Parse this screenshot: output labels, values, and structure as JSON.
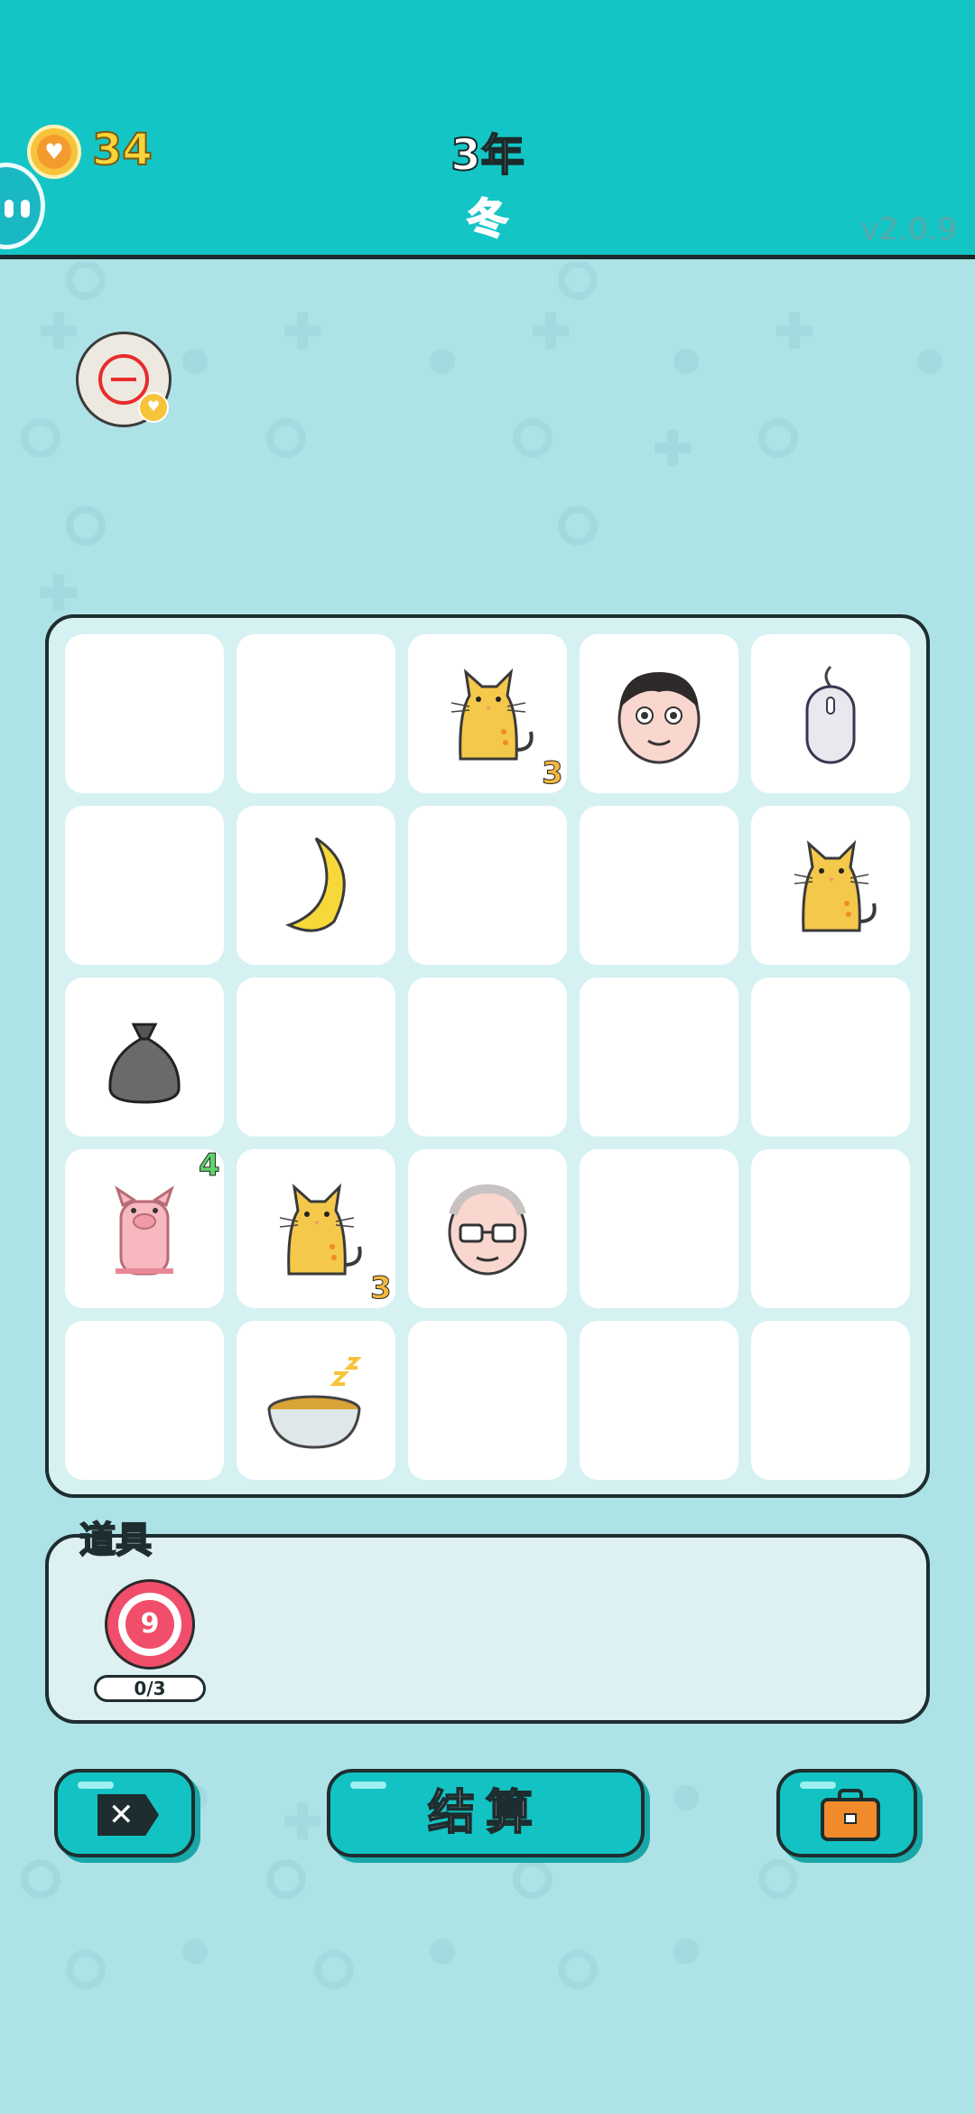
{
  "header": {
    "coins": "34",
    "year": "3年",
    "season": "冬",
    "version": "v2.0.9"
  },
  "board": {
    "rows": 5,
    "cols": 5,
    "cells": [
      {
        "row": 0,
        "col": 2,
        "item": "cat-icon",
        "badge": "3"
      },
      {
        "row": 0,
        "col": 3,
        "item": "man-face-icon"
      },
      {
        "row": 0,
        "col": 4,
        "item": "mouse-icon"
      },
      {
        "row": 1,
        "col": 1,
        "item": "banana-icon"
      },
      {
        "row": 1,
        "col": 4,
        "item": "cat-icon"
      },
      {
        "row": 2,
        "col": 0,
        "item": "trash-bag-icon"
      },
      {
        "row": 3,
        "col": 0,
        "item": "pig-icon",
        "badge": "4"
      },
      {
        "row": 3,
        "col": 1,
        "item": "cat-icon",
        "badge": "3"
      },
      {
        "row": 3,
        "col": 2,
        "item": "old-man-face-icon"
      },
      {
        "row": 4,
        "col": 1,
        "item": "soup-bowl-icon"
      }
    ]
  },
  "tools": {
    "label": "道具",
    "items": [
      {
        "name": "target-icon",
        "value": "9",
        "count": "0/3"
      }
    ]
  },
  "buttons": {
    "settle": "结算"
  },
  "colors": {
    "header": "#14C5C5",
    "background": "#ADE2E7",
    "button": "#13C3C3"
  }
}
